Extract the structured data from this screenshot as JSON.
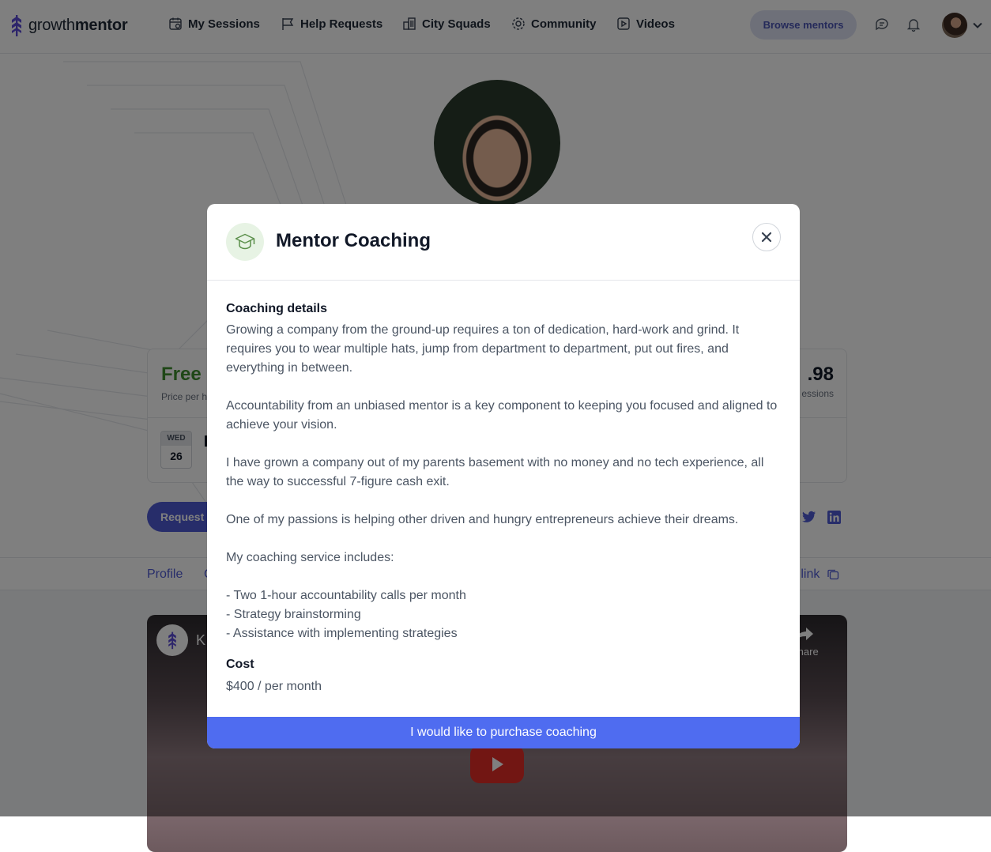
{
  "nav": {
    "logo_light": "growth",
    "logo_bold": "mentor",
    "items": [
      {
        "label": "My Sessions",
        "icon": "calendar-icon"
      },
      {
        "label": "Help Requests",
        "icon": "flag-icon"
      },
      {
        "label": "City Squads",
        "icon": "city-icon"
      },
      {
        "label": "Community",
        "icon": "community-icon"
      },
      {
        "label": "Videos",
        "icon": "video-icon"
      }
    ],
    "browse_label": "Browse mentors"
  },
  "profile": {
    "price": "Free",
    "price_sub": "Price per h",
    "rating": ".98",
    "rating_sub": "essions",
    "date_dow": "WED",
    "date_num": "26",
    "request_label": "Request",
    "tabs": {
      "profile": "Profile",
      "second": "C",
      "copy": "e link"
    },
    "video_title": "K",
    "video_share": "Share"
  },
  "modal": {
    "title": "Mentor Coaching",
    "details_heading": "Coaching details",
    "paragraphs": [
      "Growing a company from the ground-up requires a ton of dedication, hard-work and grind. It requires you to wear multiple hats, jump from department to department, put out fires, and everything in between.",
      "Accountability from an unbiased mentor is a key component to keeping you focused and aligned to achieve your vision.",
      "I have grown a company out of my parents basement with no money and no tech experience, all the way to successful 7-figure cash exit.",
      "One of my passions is helping other driven and hungry entrepreneurs achieve their dreams.",
      "My coaching service includes:"
    ],
    "list_items": [
      "- Two 1-hour accountability calls per month",
      "- Strategy brainstorming",
      "- Assistance with implementing strategies"
    ],
    "cost_heading": "Cost",
    "cost_value": "$400 / per month",
    "purchase_label": "I would like to purchase coaching"
  },
  "colors": {
    "primary": "#4f5bd5",
    "purchase": "#4f6cf0",
    "free_green": "#3f8f2f",
    "brand_purple": "#5b4bd6"
  }
}
